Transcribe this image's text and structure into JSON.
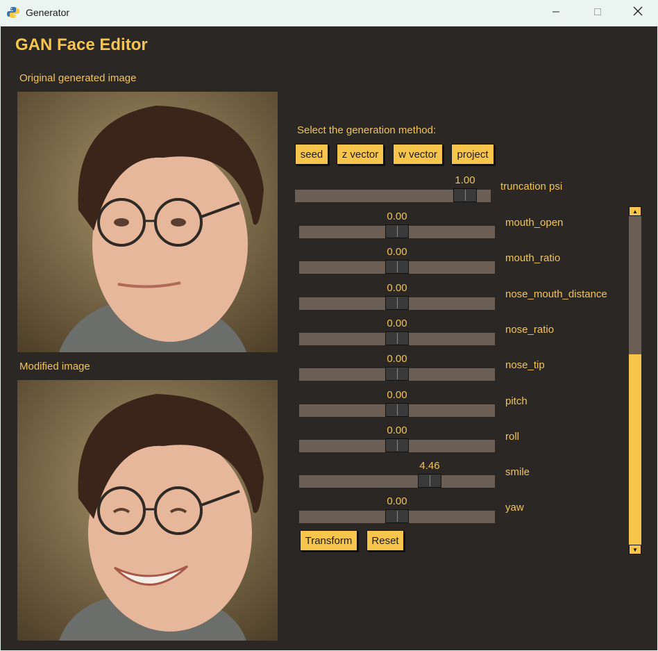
{
  "window": {
    "title": "Generator"
  },
  "app": {
    "title": "GAN Face Editor"
  },
  "images": {
    "original_label": "Original generated image",
    "modified_label": "Modified image"
  },
  "generation": {
    "prompt": "Select the generation method:",
    "buttons": [
      "seed",
      "z vector",
      "w vector",
      "project"
    ]
  },
  "truncation": {
    "label": "truncation psi",
    "value": "1.00",
    "fraction": 0.92
  },
  "sliders": [
    {
      "label": "mouth_open",
      "value": "0.00",
      "fraction": 0.5
    },
    {
      "label": "mouth_ratio",
      "value": "0.00",
      "fraction": 0.5
    },
    {
      "label": "nose_mouth_distance",
      "value": "0.00",
      "fraction": 0.5
    },
    {
      "label": "nose_ratio",
      "value": "0.00",
      "fraction": 0.5
    },
    {
      "label": "nose_tip",
      "value": "0.00",
      "fraction": 0.5
    },
    {
      "label": "pitch",
      "value": "0.00",
      "fraction": 0.5
    },
    {
      "label": "roll",
      "value": "0.00",
      "fraction": 0.5
    },
    {
      "label": "smile",
      "value": "4.46",
      "fraction": 0.69
    },
    {
      "label": "yaw",
      "value": "0.00",
      "fraction": 0.5
    }
  ],
  "actions": {
    "transform": "Transform",
    "reset": "Reset"
  },
  "scroll": {
    "position": 0.42
  },
  "colors": {
    "background": "#2b2725",
    "accent": "#f7c54b",
    "track": "#6b5e55"
  }
}
